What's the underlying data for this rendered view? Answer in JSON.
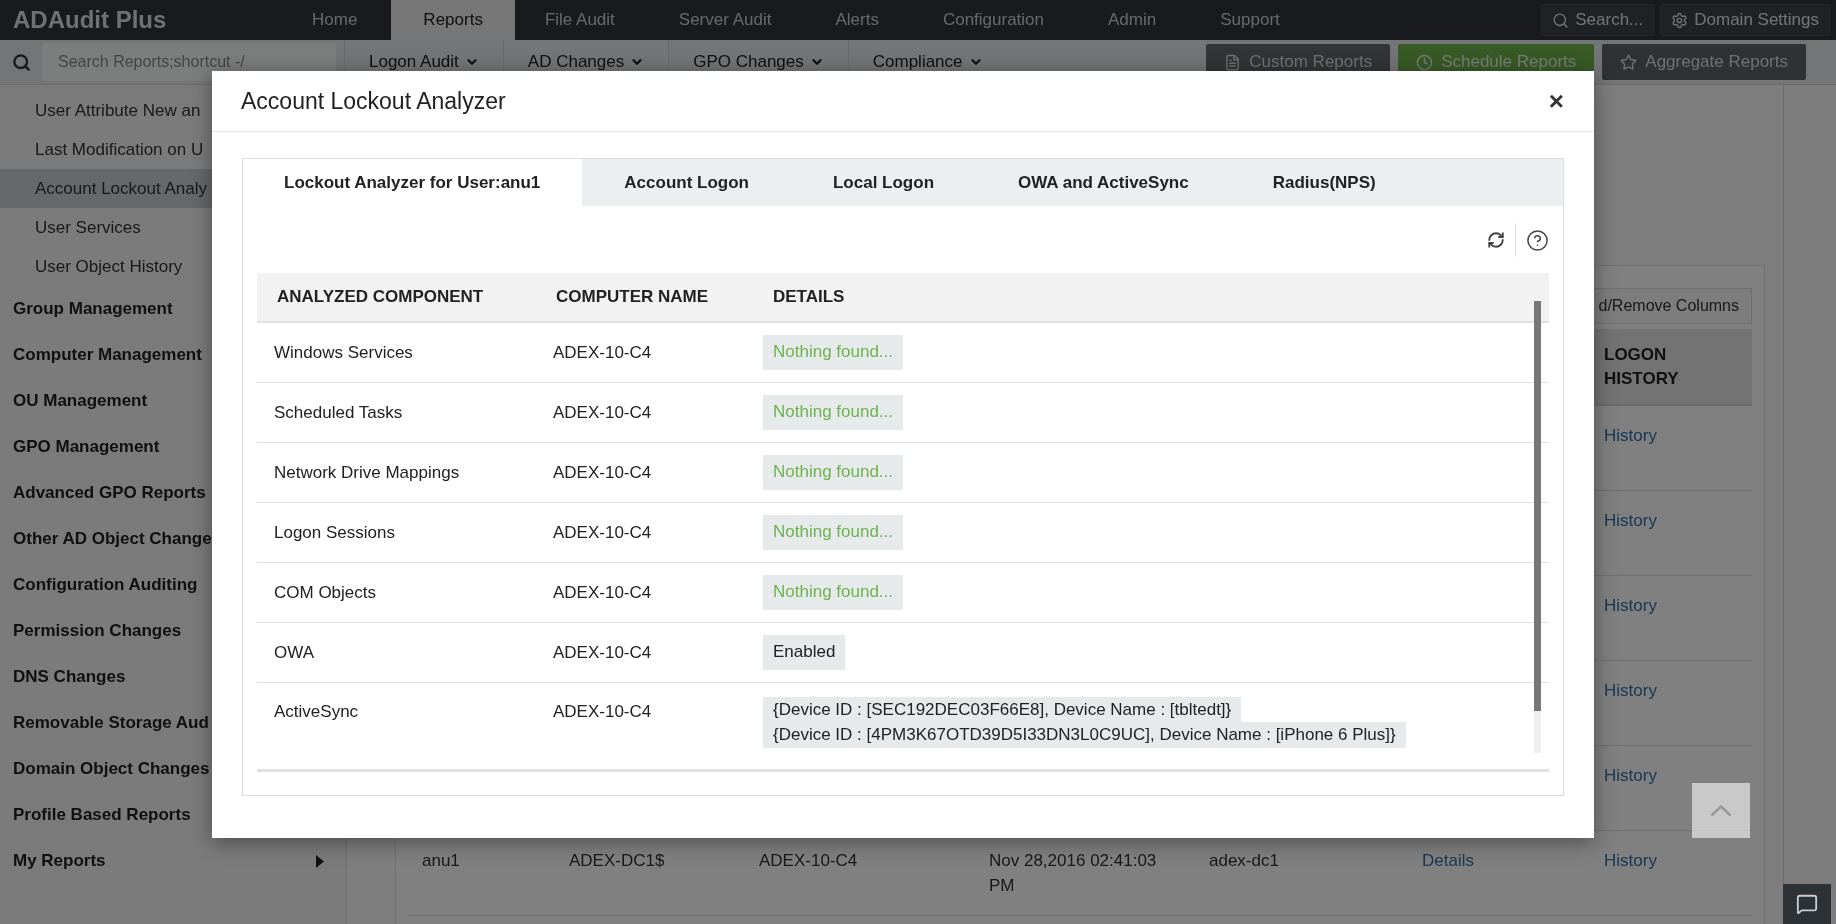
{
  "app": {
    "logo": "ADAudit Plus"
  },
  "nav": [
    {
      "label": "Home",
      "selected": false
    },
    {
      "label": "Reports",
      "selected": true
    },
    {
      "label": "File Audit",
      "selected": false
    },
    {
      "label": "Server Audit",
      "selected": false
    },
    {
      "label": "Alerts",
      "selected": false
    },
    {
      "label": "Configuration",
      "selected": false
    },
    {
      "label": "Admin",
      "selected": false
    },
    {
      "label": "Support",
      "selected": false
    }
  ],
  "header_actions": [
    {
      "label": "Search...",
      "kind": "search"
    },
    {
      "label": "Domain Settings",
      "kind": "settings"
    }
  ],
  "search": {
    "placeholder": "Search Reports;shortcut -/"
  },
  "menus": [
    "Logon Audit",
    "AD Changes",
    "GPO Changes",
    "Compliance"
  ],
  "report_buttons": [
    {
      "label": "Custom Reports",
      "kind": "custom"
    },
    {
      "label": "Schedule Reports",
      "kind": "schedule"
    },
    {
      "label": "Aggregate Reports",
      "kind": "aggregate"
    }
  ],
  "sidebar": {
    "items": [
      {
        "label": "User Attribute New an",
        "kind": "sub",
        "selected": false
      },
      {
        "label": "Last Modification on U",
        "kind": "sub",
        "selected": false
      },
      {
        "label": "Account Lockout Analy",
        "kind": "sub",
        "selected": true
      },
      {
        "label": "User Services",
        "kind": "sub",
        "selected": false
      },
      {
        "label": "User Object History",
        "kind": "sub",
        "selected": false
      },
      {
        "label": "Group Management",
        "kind": "group",
        "selected": false
      },
      {
        "label": "Computer Management",
        "kind": "group",
        "selected": false
      },
      {
        "label": "OU Management",
        "kind": "group",
        "selected": false
      },
      {
        "label": "GPO Management",
        "kind": "group",
        "selected": false
      },
      {
        "label": "Advanced GPO Reports",
        "kind": "group",
        "selected": false
      },
      {
        "label": "Other AD Object Change",
        "kind": "group",
        "selected": false
      },
      {
        "label": "Configuration Auditing",
        "kind": "group",
        "selected": false
      },
      {
        "label": "Permission Changes",
        "kind": "group",
        "selected": false
      },
      {
        "label": "DNS Changes",
        "kind": "group",
        "selected": false
      },
      {
        "label": "Removable Storage Aud",
        "kind": "group",
        "selected": false
      },
      {
        "label": "Domain Object Changes",
        "kind": "group",
        "selected": false
      },
      {
        "label": "Profile Based Reports",
        "kind": "group",
        "selected": false
      },
      {
        "label": "My Reports",
        "kind": "submenu",
        "selected": false
      }
    ]
  },
  "report": {
    "columns_button": "d/Remove Columns",
    "logon_history_heading": "LOGON HISTORY",
    "rows": [
      {
        "logon_history": "History"
      },
      {
        "logon_history": "History"
      },
      {
        "logon_history": "History"
      },
      {
        "logon_history": "History"
      },
      {
        "logon_history": "History"
      },
      {
        "column_1": "anu1",
        "column_2": "ADEX-DC1$",
        "column_3": "ADEX-10-C4",
        "column_4": "Nov 28,2016 02:41:03 PM",
        "column_5": "adex-dc1",
        "column_6": "Details",
        "logon_history": "History"
      }
    ]
  },
  "dialog": {
    "title": "Account Lockout Analyzer",
    "close": "×",
    "tabs": [
      {
        "label": "Lockout Analyzer for User:anu1",
        "selected": true
      },
      {
        "label": "Account Logon",
        "selected": false
      },
      {
        "label": "Local Logon",
        "selected": false
      },
      {
        "label": "OWA and ActiveSync",
        "selected": false
      },
      {
        "label": "Radius(NPS)",
        "selected": false
      }
    ],
    "columns": [
      "ANALYZED COMPONENT",
      "COMPUTER NAME",
      "DETAILS"
    ],
    "rows": [
      {
        "component": "Windows Services",
        "computer": "ADEX-10-C4",
        "kind": "empty",
        "details": [
          "Nothing found..."
        ]
      },
      {
        "component": "Scheduled Tasks",
        "computer": "ADEX-10-C4",
        "kind": "empty",
        "details": [
          "Nothing found..."
        ]
      },
      {
        "component": "Network Drive Mappings",
        "computer": "ADEX-10-C4",
        "kind": "empty",
        "details": [
          "Nothing found..."
        ]
      },
      {
        "component": "Logon Sessions",
        "computer": "ADEX-10-C4",
        "kind": "empty",
        "details": [
          "Nothing found..."
        ]
      },
      {
        "component": "COM Objects",
        "computer": "ADEX-10-C4",
        "kind": "empty",
        "details": [
          "Nothing found..."
        ]
      },
      {
        "component": "OWA",
        "computer": "ADEX-10-C4",
        "kind": "value",
        "details": [
          "Enabled"
        ]
      },
      {
        "component": "ActiveSync",
        "computer": "ADEX-10-C4",
        "kind": "value",
        "details": [
          "{Device ID : [SEC192DEC03F66E8], Device Name : [tbltedt]}",
          "{Device ID : [4PM3K67OTD39D5I33DN3L0C9UC], Device Name : [iPhone 6 Plus]}"
        ]
      }
    ]
  }
}
